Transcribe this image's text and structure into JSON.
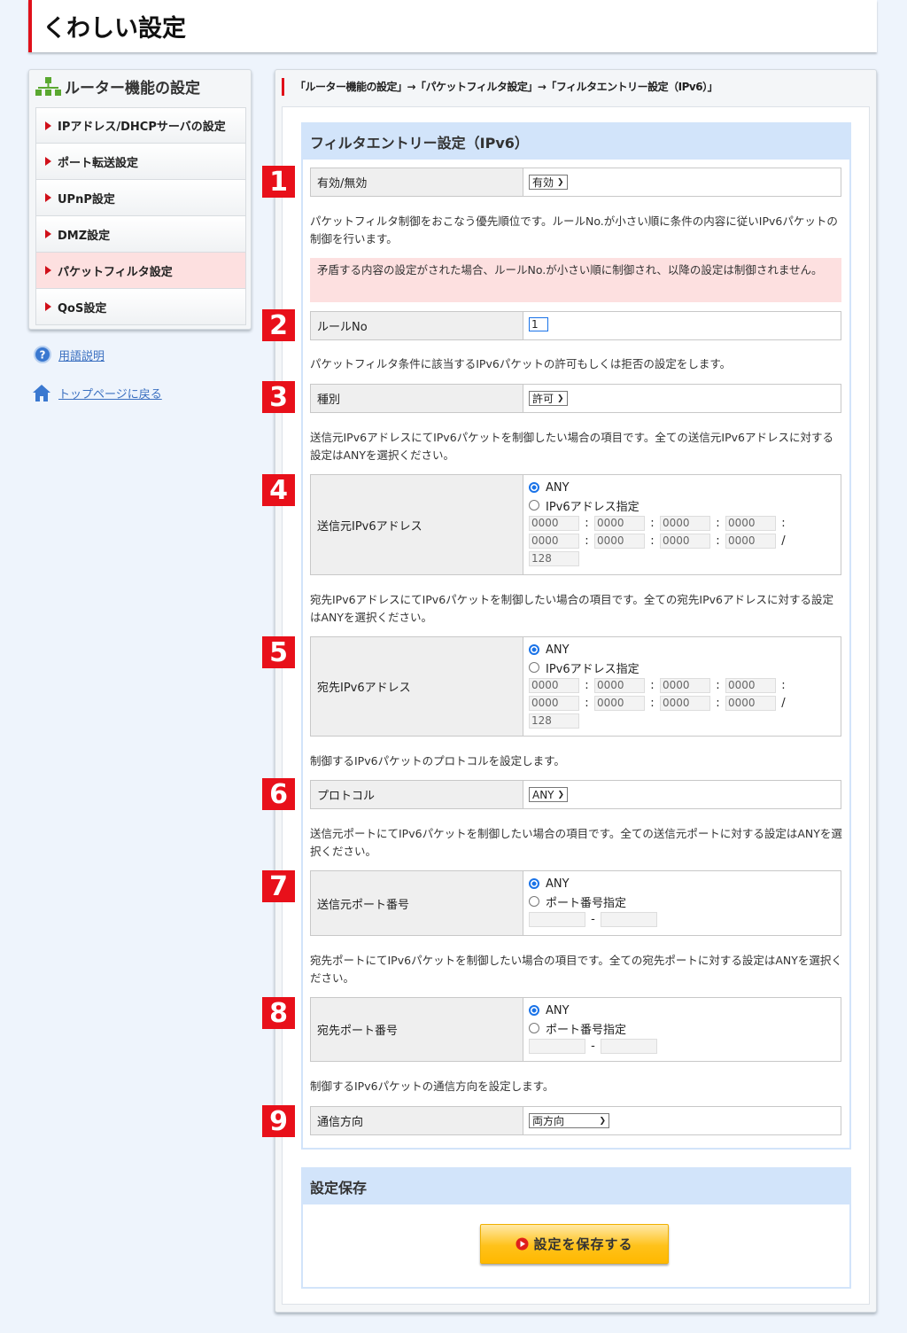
{
  "page_title": "くわしい設定",
  "sidebar": {
    "title": "ルーター機能の設定",
    "items": [
      {
        "label": "IPアドレス/DHCPサーバの設定"
      },
      {
        "label": "ポート転送設定"
      },
      {
        "label": "UPnP設定"
      },
      {
        "label": "DMZ設定"
      },
      {
        "label": "パケットフィルタ設定"
      },
      {
        "label": "QoS設定"
      }
    ],
    "help_link": "用語説明",
    "home_link": "トップページに戻る"
  },
  "breadcrumb": "「ルーター機能の設定」→「パケットフィルタ設定」→「フィルタエントリー設定（IPv6）」",
  "section": {
    "title": "フィルタエントリー設定（IPv6）",
    "enable": {
      "num": "1",
      "label": "有効/無効",
      "value": "有効"
    },
    "priority_desc": "パケットフィルタ制御をおこなう優先順位です。ルールNo.が小さい順に条件の内容に従いIPv6パケットの制御を行います。",
    "warning": "矛盾する内容の設定がされた場合、ルールNo.が小さい順に制御され、以降の設定は制御されません。",
    "rule": {
      "num": "2",
      "label": "ルールNo",
      "value": "1"
    },
    "type_desc": "パケットフィルタ条件に該当するIPv6パケットの許可もしくは拒否の設定をします。",
    "type": {
      "num": "3",
      "label": "種別",
      "value": "許可"
    },
    "src_desc": "送信元IPv6アドレスにてIPv6パケットを制御したい場合の項目です。全ての送信元IPv6アドレスに対する設定はANYを選択ください。",
    "src": {
      "num": "4",
      "label": "送信元IPv6アドレス",
      "opt_any": "ANY",
      "opt_spec": "IPv6アドレス指定",
      "fields": [
        "0000",
        "0000",
        "0000",
        "0000",
        "0000",
        "0000",
        "0000",
        "0000"
      ],
      "prefix": "128"
    },
    "dst_desc": "宛先IPv6アドレスにてIPv6パケットを制御したい場合の項目です。全ての宛先IPv6アドレスに対する設定はANYを選択ください。",
    "dst": {
      "num": "5",
      "label": "宛先IPv6アドレス",
      "opt_any": "ANY",
      "opt_spec": "IPv6アドレス指定",
      "fields": [
        "0000",
        "0000",
        "0000",
        "0000",
        "0000",
        "0000",
        "0000",
        "0000"
      ],
      "prefix": "128"
    },
    "proto_desc": "制御するIPv6パケットのプロトコルを設定します。",
    "proto": {
      "num": "6",
      "label": "プロトコル",
      "value": "ANY"
    },
    "sport_desc": "送信元ポートにてIPv6パケットを制御したい場合の項目です。全ての送信元ポートに対する設定はANYを選択ください。",
    "sport": {
      "num": "7",
      "label": "送信元ポート番号",
      "opt_any": "ANY",
      "opt_spec": "ポート番号指定"
    },
    "dport_desc": "宛先ポートにてIPv6パケットを制御したい場合の項目です。全ての宛先ポートに対する設定はANYを選択ください。",
    "dport": {
      "num": "8",
      "label": "宛先ポート番号",
      "opt_any": "ANY",
      "opt_spec": "ポート番号指定"
    },
    "dir_desc": "制御するIPv6パケットの通信方向を設定します。",
    "dir": {
      "num": "9",
      "label": "通信方向",
      "value": "両方向"
    }
  },
  "save": {
    "title": "設定保存",
    "button": "設定を保存する"
  }
}
